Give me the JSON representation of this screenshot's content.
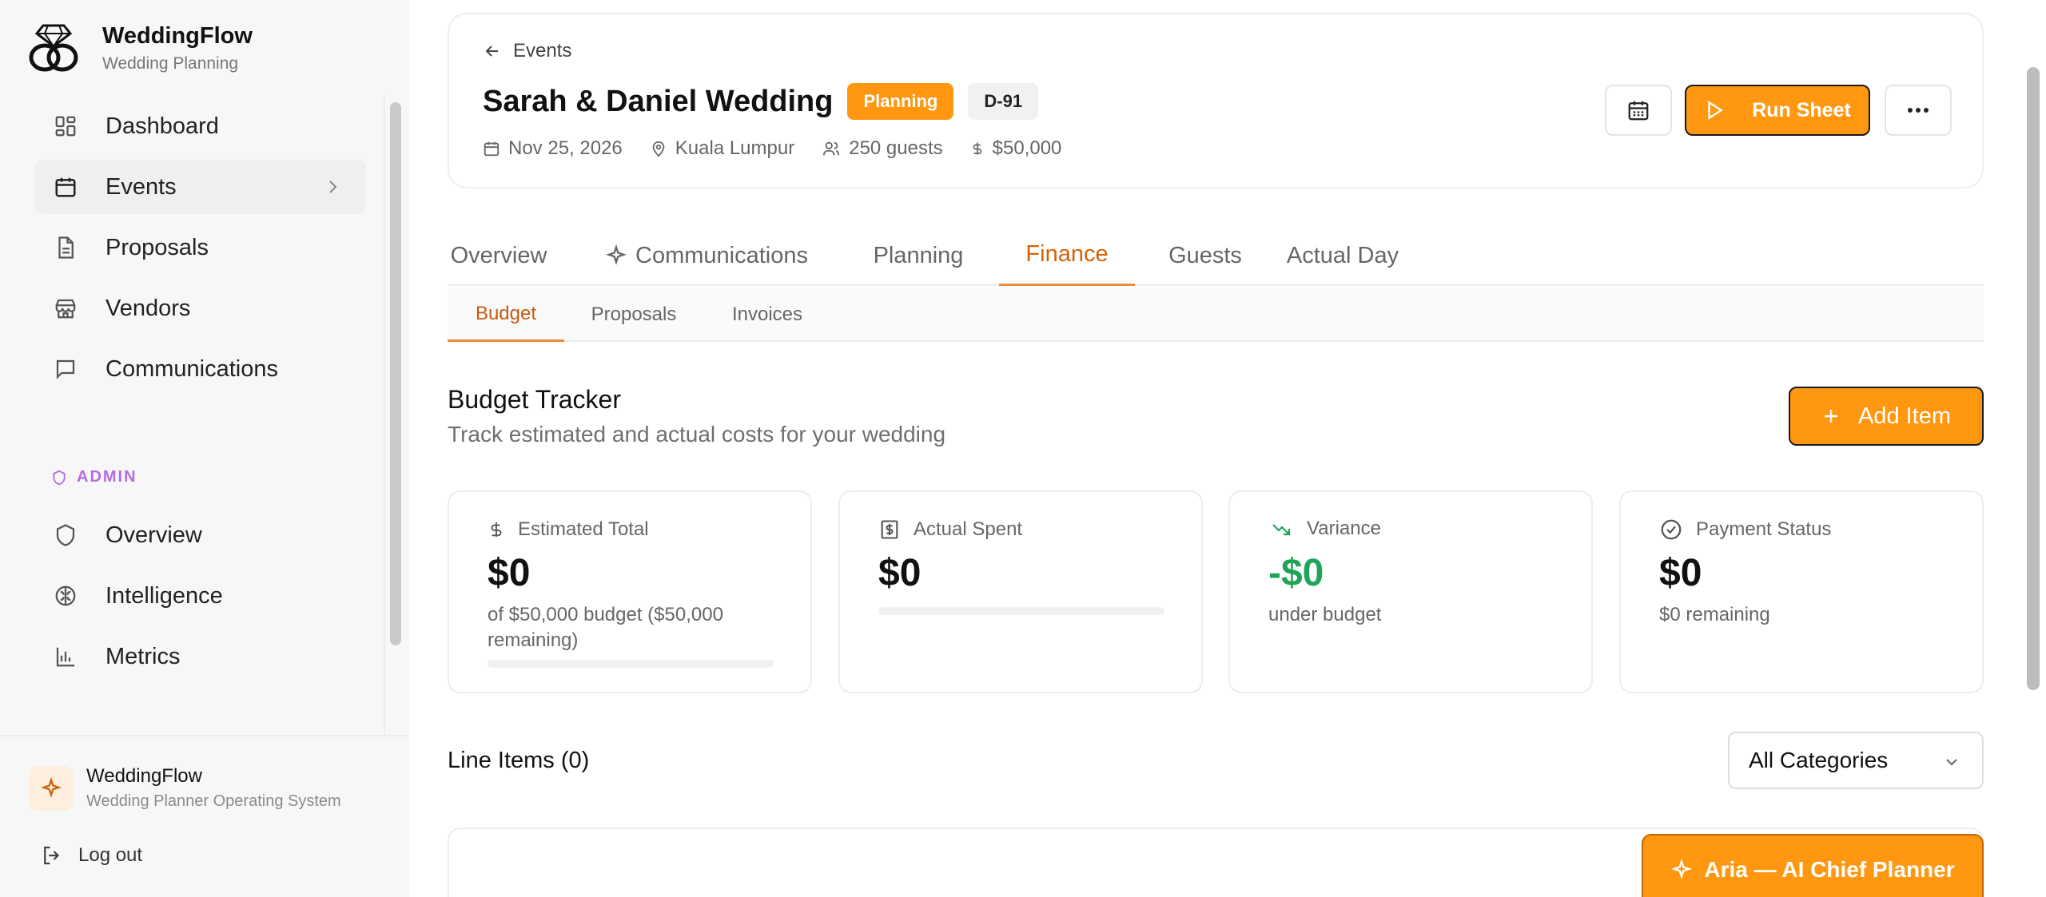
{
  "brand": {
    "name": "WeddingFlow",
    "subtitle": "Wedding Planning"
  },
  "sidebar": {
    "items": [
      {
        "label": "Dashboard",
        "icon": "dashboard-icon"
      },
      {
        "label": "Events",
        "icon": "calendar-icon",
        "active": true
      },
      {
        "label": "Proposals",
        "icon": "document-icon"
      },
      {
        "label": "Vendors",
        "icon": "store-icon"
      },
      {
        "label": "Communications",
        "icon": "chat-icon"
      }
    ],
    "admin_label": "ADMIN",
    "admin_items": [
      {
        "label": "Overview",
        "icon": "shield-icon"
      },
      {
        "label": "Intelligence",
        "icon": "brain-icon"
      },
      {
        "label": "Metrics",
        "icon": "bar-chart-icon"
      }
    ],
    "footer": {
      "title": "WeddingFlow",
      "subtitle": "Wedding Planner Operating System",
      "logout": "Log out"
    }
  },
  "event": {
    "back": "Events",
    "title": "Sarah & Daniel Wedding",
    "status": "Planning",
    "code": "D-91",
    "date": "Nov 25, 2026",
    "location": "Kuala Lumpur",
    "guests": "250 guests",
    "budget": "$50,000",
    "run_sheet": "Run Sheet"
  },
  "tabs": [
    "Overview",
    "Communications",
    "Planning",
    "Finance",
    "Guests",
    "Actual Day"
  ],
  "active_tab": "Finance",
  "subtabs": [
    "Budget",
    "Proposals",
    "Invoices"
  ],
  "active_subtab": "Budget",
  "budget": {
    "title": "Budget Tracker",
    "subtitle": "Track estimated and actual costs for your wedding",
    "add_item": "Add Item",
    "cards": [
      {
        "label": "Estimated Total",
        "value": "$0",
        "desc": "of $50,000 budget ($50,000 remaining)",
        "progress": 0
      },
      {
        "label": "Actual Spent",
        "value": "$0",
        "desc": "",
        "progress": 0
      },
      {
        "label": "Variance",
        "value": "-$0",
        "desc": "under budget"
      },
      {
        "label": "Payment Status",
        "value": "$0",
        "desc": "$0 remaining"
      }
    ]
  },
  "line_items": {
    "title": "Line Items (0)",
    "category_filter": "All Categories"
  },
  "aria": {
    "label": "Aria — AI Chief Planner"
  },
  "colors": {
    "accent": "#ff9810",
    "accent_text": "#d2620a",
    "positive": "#1fa45a",
    "admin": "#b76be0"
  }
}
